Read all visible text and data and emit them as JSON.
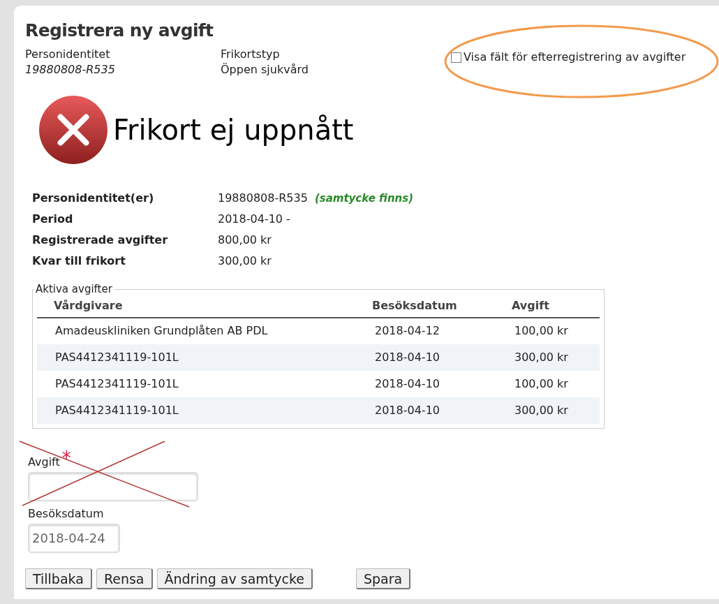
{
  "title": "Registrera ny avgift",
  "header_fields": [
    {
      "label": "Personidentitet",
      "value": "19880808-R535",
      "italic": true
    },
    {
      "label": "Frikortstyp",
      "value": "Öppen sjukvård",
      "italic": false
    }
  ],
  "late_registration": {
    "label": "Visa fält för efterregistrering av avgifter",
    "checked": false
  },
  "status": {
    "kind": "error",
    "text": "Frikort ej uppnått"
  },
  "summary": [
    {
      "label": "Personidentitet(er)",
      "value": "19880808-R535",
      "note": "(samtycke finns)"
    },
    {
      "label": "Period",
      "value": "2018-04-10 -"
    },
    {
      "label": "Registrerade avgifter",
      "value": "800,00 kr"
    },
    {
      "label": "Kvar till frikort",
      "value": "300,00 kr"
    }
  ],
  "active_fees": {
    "legend": "Aktiva avgifter",
    "columns": [
      "Vårdgivare",
      "Besöksdatum",
      "Avgift"
    ],
    "rows": [
      [
        "Amadeuskliniken Grundplåten AB PDL",
        "2018-04-12",
        "100,00 kr"
      ],
      [
        "PAS4412341119-101L",
        "2018-04-10",
        "300,00 kr"
      ],
      [
        "PAS4412341119-101L",
        "2018-04-10",
        "100,00 kr"
      ],
      [
        "PAS4412341119-101L",
        "2018-04-10",
        "300,00 kr"
      ]
    ]
  },
  "form": [
    {
      "label": "Avgift",
      "required_mark": "*",
      "crossed_out": true
    },
    {
      "label": "Besöksdatum",
      "value": "2018-04-24",
      "crossed_out": false
    }
  ],
  "buttons": [
    "Tillbaka",
    "Rensa",
    "Ändring av samtycke",
    "Spara"
  ]
}
